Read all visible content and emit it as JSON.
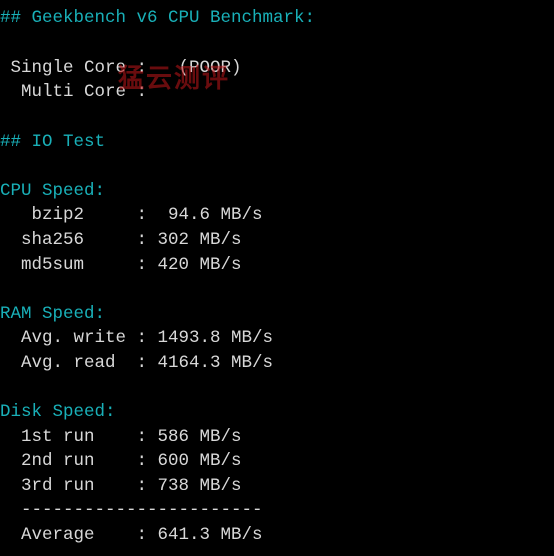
{
  "geekbench": {
    "header": "## Geekbench v6 CPU Benchmark:",
    "single_core": " Single Core :   (POOR)",
    "multi_core": "  Multi Core :"
  },
  "io_test": {
    "header": "## IO Test"
  },
  "cpu_speed": {
    "header": "CPU Speed:",
    "rows": [
      "   bzip2     :  94.6 MB/s",
      "  sha256     : 302 MB/s",
      "  md5sum     : 420 MB/s"
    ]
  },
  "ram_speed": {
    "header": "RAM Speed:",
    "rows": [
      "  Avg. write : 1493.8 MB/s",
      "  Avg. read  : 4164.3 MB/s"
    ]
  },
  "disk_speed": {
    "header": "Disk Speed:",
    "rows": [
      "  1st run    : 586 MB/s",
      "  2nd run    : 600 MB/s",
      "  3rd run    : 738 MB/s"
    ],
    "divider": "  -----------------------",
    "average": "  Average    : 641.3 MB/s"
  },
  "watermark": "猛云测评",
  "colors": {
    "background": "#000000",
    "header": "#19b0b8",
    "text": "#d8d8d8",
    "watermark": "#c0161a"
  }
}
